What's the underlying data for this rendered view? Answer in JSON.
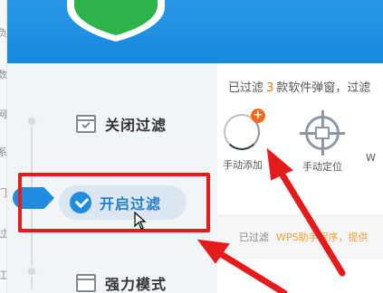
{
  "left_strip": {
    "chars": [
      "负",
      "数",
      "网",
      "系",
      "门",
      "过",
      "江"
    ]
  },
  "nav": {
    "items": [
      {
        "label": "关闭过滤",
        "icon": "checkbox-window-icon"
      },
      {
        "label": "开启过滤",
        "icon": "check-circle-icon",
        "active": true
      },
      {
        "label": "强力模式",
        "icon": "window-icon"
      }
    ]
  },
  "main": {
    "summary_prefix": "已过滤",
    "summary_count": "3",
    "summary_suffix": "款软件弹窗，过滤",
    "tools": [
      {
        "label": "手动添加",
        "icon": "add-ring-icon",
        "badge": "+"
      },
      {
        "label": "手动定位",
        "icon": "crosshair-target-icon"
      },
      {
        "label": "W"
      }
    ],
    "filtered_label": "已过滤",
    "filtered_value": "WPS助手程序，提供"
  },
  "colors": {
    "header_blue": "#1f8ce0",
    "accent_orange": "#f07a10",
    "highlight_red": "#e51a1a"
  }
}
